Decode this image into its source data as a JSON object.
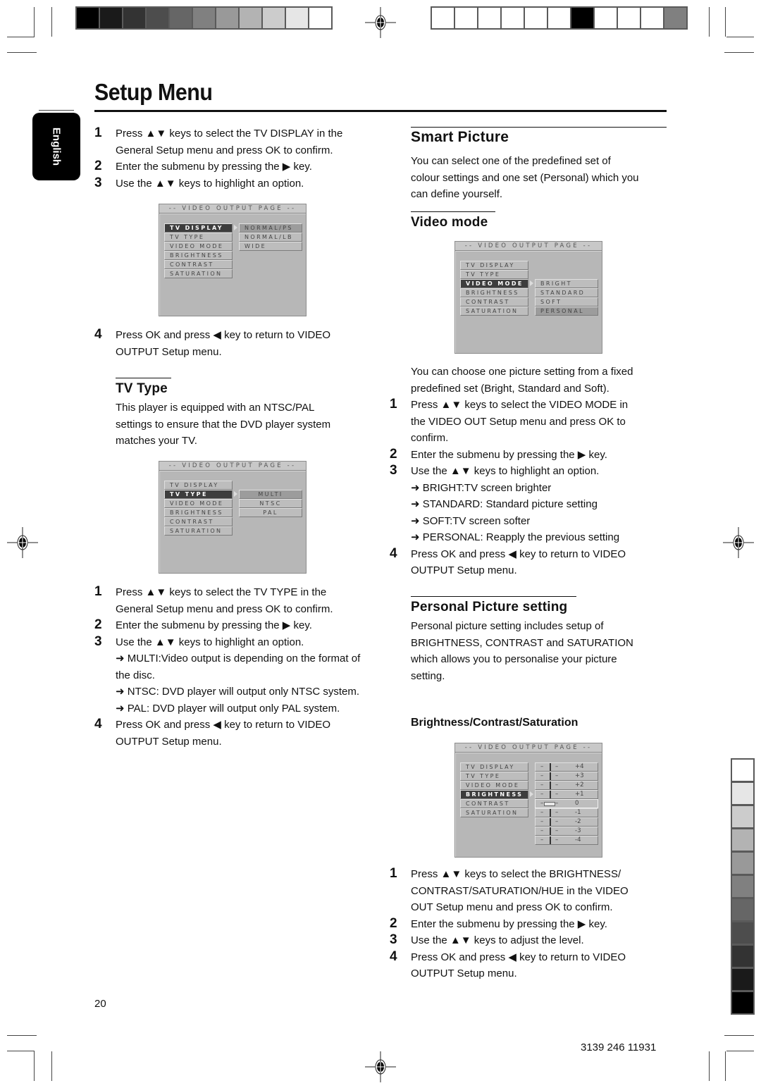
{
  "header": {
    "title": "Setup Menu",
    "language_tab": "English"
  },
  "print_marks": {
    "top_left_swatches": [
      "#000000",
      "#1a1a1a",
      "#333333",
      "#4d4d4d",
      "#666666",
      "#808080",
      "#999999",
      "#b3b3b3",
      "#cccccc",
      "#e6e6e6",
      "#ffffff"
    ],
    "top_right_swatches": [
      "#ffffff",
      "#ffffff",
      "#ffffff",
      "#ffffff",
      "#ffffff",
      "#ffffff",
      "#000000",
      "#ffffff",
      "#ffffff",
      "#ffffff",
      "#808080"
    ],
    "side_swatches": [
      "#ffffff",
      "#e6e6e6",
      "#cccccc",
      "#b3b3b3",
      "#999999",
      "#808080",
      "#666666",
      "#4d4d4d",
      "#333333",
      "#1a1a1a",
      "#000000"
    ]
  },
  "tv_display": {
    "steps": [
      {
        "num": "1",
        "lines": [
          "Press ▲▼ keys to select the TV DISPLAY in the",
          "General Setup menu and press OK to confirm."
        ]
      },
      {
        "num": "2",
        "lines": [
          "Enter the submenu by pressing the ▶ key."
        ]
      },
      {
        "num": "3",
        "lines": [
          "Use the ▲▼ keys to highlight an option."
        ]
      }
    ],
    "osd": {
      "title": "-- VIDEO OUTPUT PAGE --",
      "menu": [
        "TV DISPLAY",
        "TV TYPE",
        "VIDEO MODE",
        "BRIGHTNESS",
        "CONTRAST",
        "SATURATION"
      ],
      "selected": "TV DISPLAY",
      "options": [
        "NORMAL/PS",
        "NORMAL/LB",
        "WIDE"
      ],
      "highlighted_option": "NORMAL/PS"
    },
    "step4": {
      "num": "4",
      "lines": [
        "Press OK and press ◀ key to return to VIDEO",
        "OUTPUT Setup menu."
      ]
    }
  },
  "tv_type": {
    "heading": "TV Type",
    "intro": [
      "This player is equipped with an NTSC/PAL",
      "settings to ensure that the DVD player system",
      "matches your TV."
    ],
    "osd": {
      "title": "-- VIDEO OUTPUT PAGE --",
      "menu": [
        "TV DISPLAY",
        "TV TYPE",
        "VIDEO MODE",
        "BRIGHTNESS",
        "CONTRAST",
        "SATURATION"
      ],
      "selected": "TV TYPE",
      "options": [
        "MULTI",
        "NTSC",
        "PAL"
      ],
      "highlighted_option": "MULTI"
    },
    "steps": [
      {
        "num": "1",
        "lines": [
          "Press ▲▼ keys to select the TV TYPE in the",
          "General Setup menu and press OK to confirm."
        ]
      },
      {
        "num": "2",
        "lines": [
          "Enter the submenu by pressing the ▶ key."
        ]
      },
      {
        "num": "3",
        "lines": [
          "Use the ▲▼ keys to highlight an option."
        ],
        "bullets": [
          "MULTI:Video output is depending on the format of the disc.",
          "NTSC: DVD player will output only NTSC system.",
          "PAL: DVD player will output only PAL system."
        ]
      },
      {
        "num": "4",
        "lines": [
          "Press OK and press ◀ key to return to VIDEO",
          "OUTPUT Setup menu."
        ]
      }
    ]
  },
  "smart_picture": {
    "heading": "Smart Picture",
    "intro": [
      "You can select one of the predefined set of",
      "colour settings and one set (Personal) which you",
      "can define yourself."
    ]
  },
  "video_mode": {
    "heading": "Video mode",
    "osd": {
      "title": "-- VIDEO OUTPUT PAGE --",
      "menu": [
        "TV DISPLAY",
        "TV TYPE",
        "VIDEO MODE",
        "BRIGHTNESS",
        "CONTRAST",
        "SATURATION"
      ],
      "selected": "VIDEO MODE",
      "options": [
        "BRIGHT",
        "STANDARD",
        "SOFT",
        "PERSONAL"
      ],
      "highlighted_option": "PERSONAL"
    },
    "intro": [
      "You can choose one picture setting from a fixed",
      "predefined set (Bright, Standard and Soft)."
    ],
    "steps": [
      {
        "num": "1",
        "lines": [
          "Press ▲▼ keys to select the VIDEO MODE in",
          "the VIDEO OUT Setup menu and press OK to",
          "confirm."
        ]
      },
      {
        "num": "2",
        "lines": [
          "Enter the submenu by pressing the ▶ key."
        ]
      },
      {
        "num": "3",
        "lines": [
          "Use the ▲▼ keys to highlight an option."
        ],
        "bullets": [
          "BRIGHT:TV screen brighter",
          "STANDARD: Standard picture setting",
          "SOFT:TV screen softer",
          "PERSONAL: Reapply the previous setting"
        ]
      },
      {
        "num": "4",
        "lines": [
          "Press OK and press ◀ key to return to VIDEO",
          "OUTPUT Setup menu."
        ]
      }
    ]
  },
  "personal_picture": {
    "heading": "Personal Picture setting",
    "intro": [
      "Personal picture setting includes setup of",
      "BRIGHTNESS, CONTRAST and SATURATION",
      "which allows you to personalise your picture",
      "setting."
    ],
    "subheading": "Brightness/Contrast/Saturation",
    "osd": {
      "title": "-- VIDEO OUTPUT PAGE --",
      "menu": [
        "TV DISPLAY",
        "TV TYPE",
        "VIDEO MODE",
        "BRIGHTNESS",
        "CONTRAST",
        "SATURATION"
      ],
      "selected": "BRIGHTNESS",
      "levels": [
        "+4",
        "+3",
        "+2",
        "+1",
        "0",
        "-1",
        "-2",
        "-3",
        "-4"
      ],
      "current_level": "0"
    },
    "steps": [
      {
        "num": "1",
        "lines": [
          "Press ▲▼ keys to select the BRIGHTNESS/",
          "CONTRAST/SATURATION/HUE in the VIDEO",
          "OUT Setup menu and press OK to confirm."
        ]
      },
      {
        "num": "2",
        "lines": [
          "Enter the submenu by pressing the ▶ key."
        ]
      },
      {
        "num": "3",
        "lines": [
          "Use the ▲▼ keys to adjust the level."
        ]
      },
      {
        "num": "4",
        "lines": [
          "Press OK and press ◀ key to return to VIDEO",
          "OUTPUT Setup menu."
        ]
      }
    ]
  },
  "footer": {
    "page_number": "20",
    "code": "3139 246 11931"
  }
}
